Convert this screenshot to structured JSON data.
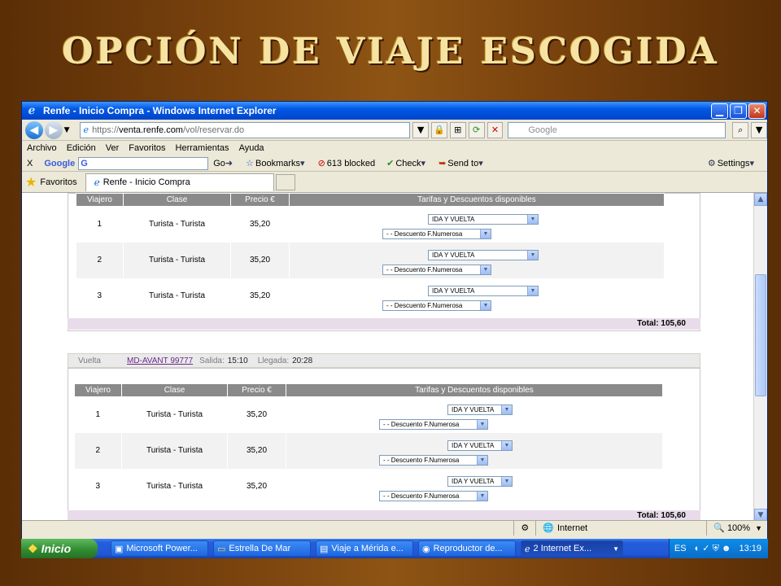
{
  "slide": {
    "title": "Opción de viaje escogida"
  },
  "window": {
    "title": "Renfe - Inicio Compra - Windows Internet Explorer",
    "url_scheme": "https://",
    "url_host": "venta.renfe.com",
    "url_path": "/vol/reservar.do",
    "search_placeholder": "Google"
  },
  "menu": [
    "Archivo",
    "Edición",
    "Ver",
    "Favoritos",
    "Herramientas",
    "Ayuda"
  ],
  "google_bar": {
    "close": "X",
    "logo": "Google",
    "input_value": "G",
    "go": "Go",
    "bookmarks": "Bookmarks",
    "blocked": "613 blocked",
    "check": "Check",
    "send_to": "Send to",
    "settings": "Settings"
  },
  "tabs": {
    "favorites": "Favoritos",
    "active_tab": "Renfe - Inicio Compra"
  },
  "table_headers": {
    "viajero": "Viajero",
    "clase": "Clase",
    "precio": "Precio €",
    "tarifas": "Tarifas y Descuentos disponibles"
  },
  "ida": {
    "rows": [
      {
        "viajero": "1",
        "clase": "Turista - Turista",
        "precio": "35,20",
        "tarifa": "IDA Y VUELTA",
        "descuento": "- - Descuento F.Numerosa"
      },
      {
        "viajero": "2",
        "clase": "Turista - Turista",
        "precio": "35,20",
        "tarifa": "IDA Y VUELTA",
        "descuento": "- - Descuento F.Numerosa"
      },
      {
        "viajero": "3",
        "clase": "Turista - Turista",
        "precio": "35,20",
        "tarifa": "IDA Y VUELTA",
        "descuento": "- - Descuento F.Numerosa"
      }
    ],
    "total": "Total: 105,60"
  },
  "vuelta": {
    "label": "Vuelta",
    "train": "MD-AVANT 99777",
    "salida_label": "Salida:",
    "salida": "15:10",
    "llegada_label": "Llegada:",
    "llegada": "20:28",
    "rows": [
      {
        "viajero": "1",
        "clase": "Turista - Turista",
        "precio": "35,20",
        "tarifa": "IDA Y VUELTA",
        "descuento": "- - Descuento F.Numerosa"
      },
      {
        "viajero": "2",
        "clase": "Turista - Turista",
        "precio": "35,20",
        "tarifa": "IDA Y VUELTA",
        "descuento": "- - Descuento F.Numerosa"
      },
      {
        "viajero": "3",
        "clase": "Turista - Turista",
        "precio": "35,20",
        "tarifa": "IDA Y VUELTA",
        "descuento": "- - Descuento F.Numerosa"
      }
    ],
    "total": "Total: 105,60"
  },
  "status": {
    "zone": "Internet",
    "zoom": "100%"
  },
  "taskbar": {
    "start": "Inicio",
    "items": [
      "Microsoft Power...",
      "Estrella De Mar",
      "Viaje a Mérida e...",
      "Reproductor de...",
      "2 Internet Ex..."
    ],
    "lang": "ES",
    "clock": "13:19"
  },
  "colors": {
    "header_gray": "#8a8a8a",
    "total_bg": "#e9dcea",
    "link_purple": "#6a2a8a",
    "xp_blue": "#0058e6"
  }
}
